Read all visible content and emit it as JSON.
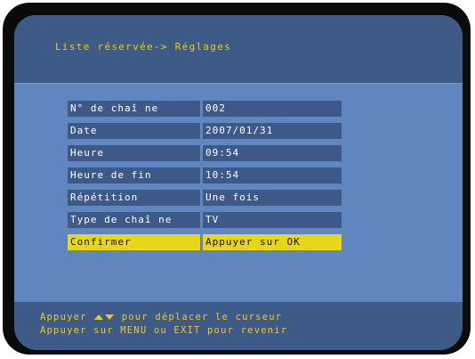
{
  "header": {
    "title": "Liste réservée-> Réglages"
  },
  "rows": [
    {
      "label": "N° de chaî ne",
      "value": "002"
    },
    {
      "label": "Date",
      "value": "2007/01/31"
    },
    {
      "label": "Heure",
      "value": "09:54"
    },
    {
      "label": "Heure de fin",
      "value": "10:54"
    },
    {
      "label": "Répétition",
      "value": "Une fois"
    },
    {
      "label": "Type de chaî ne",
      "value": "TV"
    },
    {
      "label": "Confirmer",
      "value": "Appuyer sur OK",
      "selected": true
    }
  ],
  "footer": {
    "line1_prefix": "Appuyer",
    "line1_suffix": "pour déplacer le curseur",
    "line2": "Appuyer sur MENU ou EXIT pour revenir"
  },
  "colors": {
    "accent_text": "#f0c81e",
    "selected_row": "#e8d718",
    "row_background": "#3d598a",
    "panel_background": "#5f86bf",
    "header_background": "#3e5a86"
  },
  "icons": {
    "cursor_keys": [
      "up-arrow-icon",
      "down-arrow-icon"
    ]
  }
}
